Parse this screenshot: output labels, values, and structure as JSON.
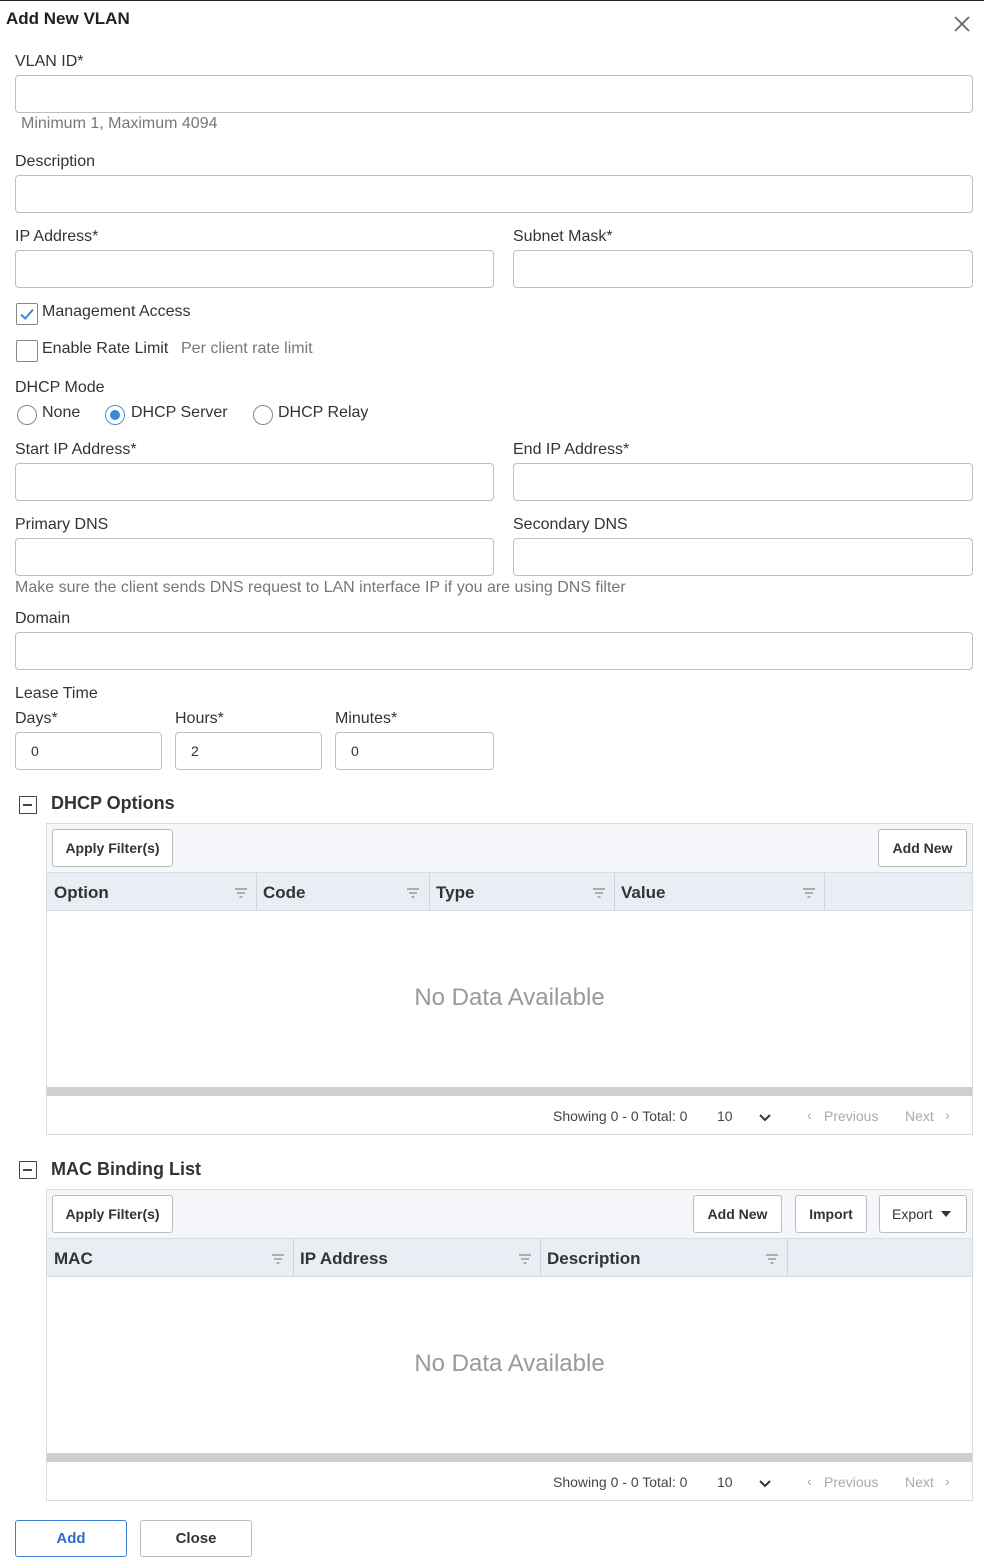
{
  "dialog": {
    "title": "Add New VLAN"
  },
  "form": {
    "vlan_id": {
      "label": "VLAN ID*",
      "value": "",
      "hint": "Minimum 1, Maximum 4094"
    },
    "description": {
      "label": "Description",
      "value": ""
    },
    "ip_address": {
      "label": "IP Address*",
      "value": ""
    },
    "subnet_mask": {
      "label": "Subnet Mask*",
      "value": ""
    },
    "management_access": {
      "label": "Management Access",
      "checked": true
    },
    "rate_limit": {
      "label": "Enable Rate Limit",
      "hint": "Per client rate limit",
      "checked": false
    },
    "dhcp_mode": {
      "label": "DHCP Mode",
      "options": [
        "None",
        "DHCP Server",
        "DHCP Relay"
      ],
      "selected": "DHCP Server"
    },
    "start_ip": {
      "label": "Start IP Address*",
      "value": ""
    },
    "end_ip": {
      "label": "End IP Address*",
      "value": ""
    },
    "primary_dns": {
      "label": "Primary DNS",
      "value": ""
    },
    "secondary_dns": {
      "label": "Secondary DNS",
      "value": ""
    },
    "dns_hint": "Make sure the client sends DNS request to LAN interface IP if you are using DNS filter",
    "domain": {
      "label": "Domain",
      "value": ""
    },
    "lease_time": {
      "label": "Lease Time",
      "days": {
        "label": "Days*",
        "value": "0"
      },
      "hours": {
        "label": "Hours*",
        "value": "2"
      },
      "minutes": {
        "label": "Minutes*",
        "value": "0"
      }
    }
  },
  "dhcp_options": {
    "title": "DHCP Options",
    "apply_filters": "Apply Filter(s)",
    "add_new": "Add New",
    "columns": [
      "Option",
      "Code",
      "Type",
      "Value"
    ],
    "empty": "No Data Available",
    "footer": {
      "showing": "Showing 0 - 0 Total: 0",
      "page_size": "10",
      "previous": "Previous",
      "next": "Next"
    }
  },
  "mac_binding": {
    "title": "MAC Binding List",
    "apply_filters": "Apply Filter(s)",
    "add_new": "Add New",
    "import": "Import",
    "export": "Export",
    "columns": [
      "MAC",
      "IP Address",
      "Description"
    ],
    "empty": "No Data Available",
    "footer": {
      "showing": "Showing 0 - 0 Total: 0",
      "page_size": "10",
      "previous": "Previous",
      "next": "Next"
    }
  },
  "actions": {
    "add": "Add",
    "close": "Close"
  },
  "colors": {
    "accent": "#3b86db",
    "table_header_bg": "#e9eef5",
    "panel_bg": "#f4f6f9"
  }
}
